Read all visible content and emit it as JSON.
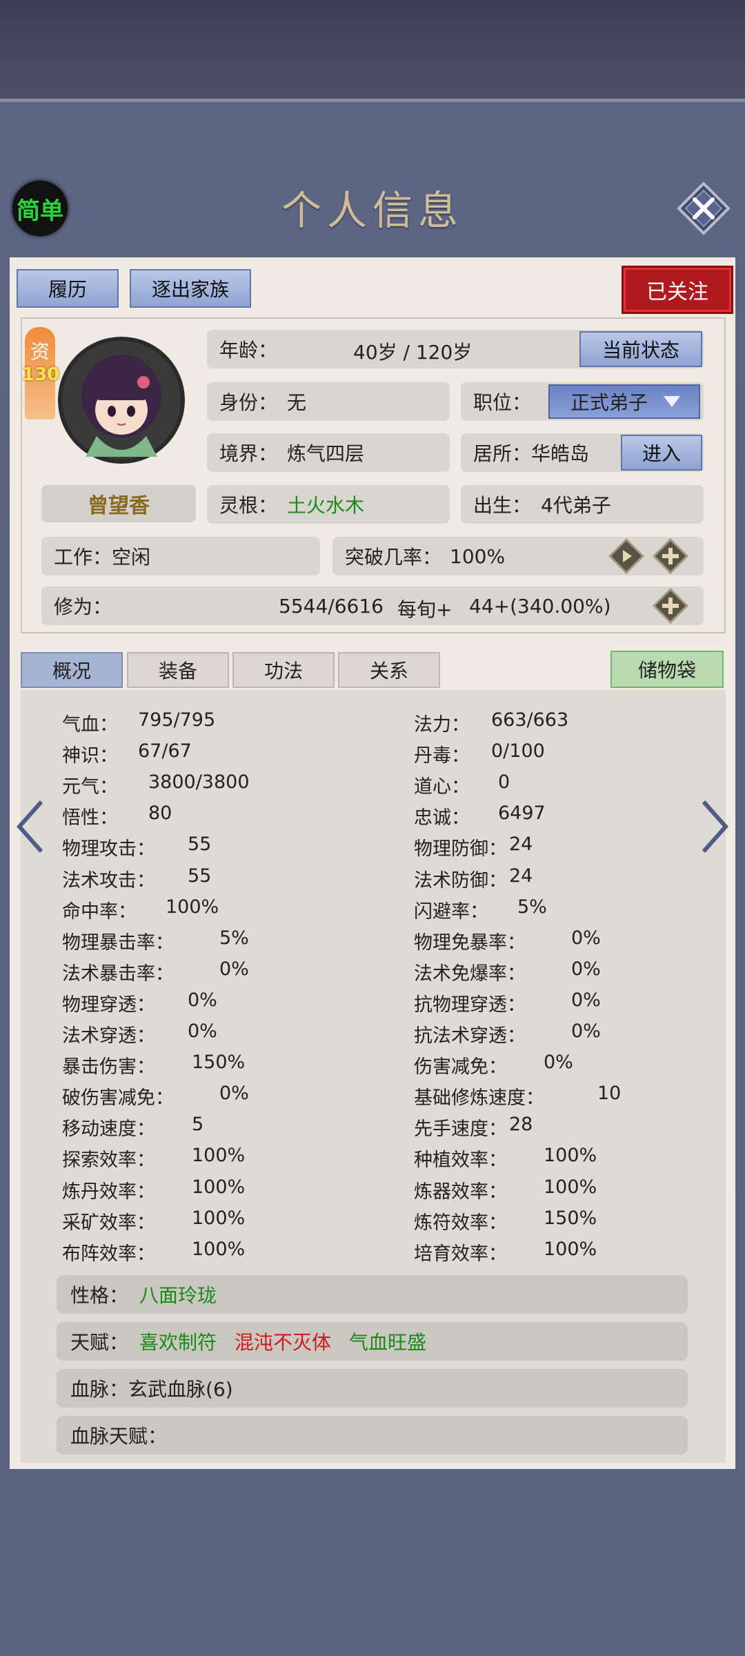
{
  "header": {
    "title": "个人信息",
    "simple_label": "简单"
  },
  "top_buttons": {
    "resume": "履历",
    "expel": "逐出家族",
    "followed": "已关注"
  },
  "character": {
    "aptitude_label": "资",
    "aptitude_value": "130",
    "name": "曾望香"
  },
  "info": {
    "age_label": "年龄：",
    "age_value": "40岁 / 120岁",
    "status_button": "当前状态",
    "identity_label": "身份：",
    "identity_value": "无",
    "position_label": "职位：",
    "position_value": "正式弟子",
    "realm_label": "境界：",
    "realm_value": "炼气四层",
    "residence_label": "居所：",
    "residence_value": "华皓岛",
    "enter_button": "进入",
    "root_label": "灵根：",
    "root_value": "土火水木",
    "birth_label": "出生：",
    "birth_value": "4代弟子",
    "work_label": "工作：",
    "work_value": "空闲",
    "breakthrough_label": "突破几率：",
    "breakthrough_value": "100%",
    "cultivation_label": "修为：",
    "cultivation_value": "5544/6616",
    "per_turn_label": "每旬+",
    "per_turn_value": "44+(340.00%)"
  },
  "tabs": [
    "概况",
    "装备",
    "功法",
    "关系"
  ],
  "storage_button": "储物袋",
  "stats_left": [
    {
      "label": "气血：",
      "value": "795/795"
    },
    {
      "label": "神识：",
      "value": "67/67"
    },
    {
      "label": "元气：",
      "value": "3800/3800"
    },
    {
      "label": "悟性：",
      "value": "80"
    },
    {
      "label": "物理攻击：",
      "value": "55"
    },
    {
      "label": "法术攻击：",
      "value": "55"
    },
    {
      "label": "命中率：",
      "value": "100%"
    },
    {
      "label": "物理暴击率：",
      "value": "5%"
    },
    {
      "label": "法术暴击率：",
      "value": "0%"
    },
    {
      "label": "物理穿透：",
      "value": "0%"
    },
    {
      "label": "法术穿透：",
      "value": "0%"
    },
    {
      "label": "暴击伤害：",
      "value": "150%"
    },
    {
      "label": "破伤害减免：",
      "value": "0%"
    },
    {
      "label": "移动速度：",
      "value": "5"
    },
    {
      "label": "探索效率：",
      "value": "100%"
    },
    {
      "label": "炼丹效率：",
      "value": "100%"
    },
    {
      "label": "采矿效率：",
      "value": "100%"
    },
    {
      "label": "布阵效率：",
      "value": "100%"
    }
  ],
  "stats_right": [
    {
      "label": "法力：",
      "value": "663/663"
    },
    {
      "label": "丹毒：",
      "value": "0/100"
    },
    {
      "label": "道心：",
      "value": "0"
    },
    {
      "label": "忠诚：",
      "value": "6497"
    },
    {
      "label": "物理防御：",
      "value": "24"
    },
    {
      "label": "法术防御：",
      "value": "24"
    },
    {
      "label": "闪避率：",
      "value": "5%"
    },
    {
      "label": "物理免暴率：",
      "value": "0%"
    },
    {
      "label": "法术免爆率：",
      "value": "0%"
    },
    {
      "label": "抗物理穿透：",
      "value": "0%"
    },
    {
      "label": "抗法术穿透：",
      "value": "0%"
    },
    {
      "label": "伤害减免：",
      "value": "0%"
    },
    {
      "label": "基础修炼速度：",
      "value": "10"
    },
    {
      "label": "先手速度：",
      "value": "28"
    },
    {
      "label": "种植效率：",
      "value": "100%"
    },
    {
      "label": "炼器效率：",
      "value": "100%"
    },
    {
      "label": "炼符效率：",
      "value": "150%"
    },
    {
      "label": "培育效率：",
      "value": "100%"
    }
  ],
  "traits": {
    "personality_label": "性格：",
    "personality_value": "八面玲珑",
    "talent_label": "天赋：",
    "talent_1": "喜欢制符",
    "talent_2": "混沌不灭体",
    "talent_3": "气血旺盛",
    "bloodline_label": "血脉：",
    "bloodline_value": "玄武血脉(6)",
    "bloodline_talent_label": "血脉天赋："
  },
  "colors": {
    "green_text": "#1a8b1a",
    "red_text": "#d21a1a",
    "followed_bg": "#b01a1e"
  }
}
